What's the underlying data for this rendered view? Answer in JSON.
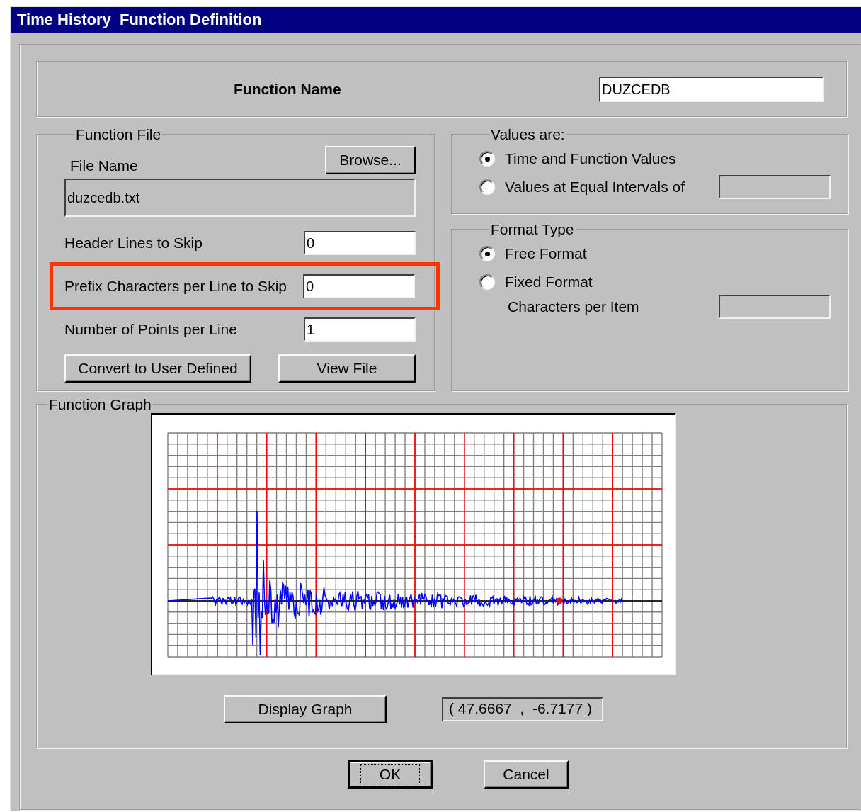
{
  "window": {
    "title": "Time History  Function Definition"
  },
  "function_name": {
    "label": "Function Name",
    "value": "DUZCEDB"
  },
  "function_file": {
    "legend": "Function File",
    "browse_button": "Browse...",
    "file_name_label": "File Name",
    "file_name": {
      "value": "duzcedb.txt",
      "disabled": true
    },
    "fields": [
      {
        "label": "Header Lines to Skip",
        "value": "0",
        "highlighted": false
      },
      {
        "label": "Prefix Characters per Line to Skip",
        "value": "0",
        "highlighted": true
      },
      {
        "label": "Number of Points per Line",
        "value": "1",
        "highlighted": false
      }
    ],
    "buttons": [
      "Convert to User Defined",
      "View File"
    ]
  },
  "values_are": {
    "legend": "Values are:",
    "options": [
      {
        "label": "Time and Function Values",
        "selected": true
      },
      {
        "label": "Values at Equal Intervals of",
        "selected": false,
        "field": {
          "disabled": true
        }
      }
    ]
  },
  "format_type": {
    "legend": "Format Type",
    "options": [
      {
        "label": "Free Format",
        "selected": true
      },
      {
        "label": "Fixed Format",
        "selected": false
      }
    ],
    "characters_per_item": {
      "label": "Characters per Item",
      "disabled": true
    }
  },
  "function_graph": {
    "legend": "Function Graph",
    "display_button": "Display Graph",
    "cursor_readout": "( 47.6667  ,  -6.7177 )"
  },
  "buttons": [
    {
      "label": "OK",
      "default": true
    },
    {
      "label": "Cancel",
      "default": false
    }
  ]
}
